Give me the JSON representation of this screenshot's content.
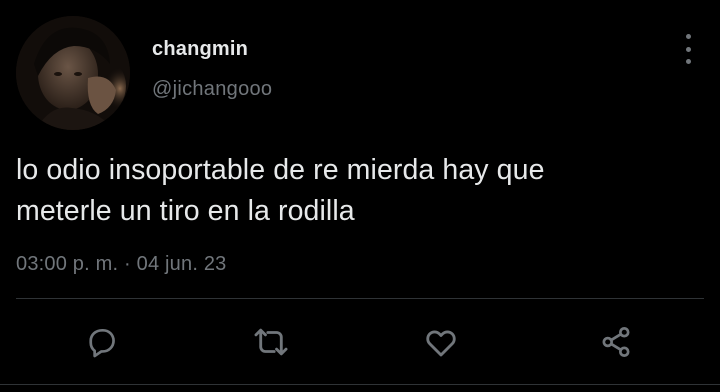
{
  "user": {
    "display_name": "changmin",
    "handle": "@jichangooo",
    "avatar": "profile-photo"
  },
  "tweet": {
    "text_line_1": "lo odio insoportable de re mierda hay que",
    "text_line_2": "meterle un tiro en la rodilla",
    "timestamp": "03:00 p. m. · 04 jun. 23"
  },
  "actions": {
    "reply_icon": "speech-bubble-icon",
    "retweet_icon": "retweet-icon",
    "like_icon": "heart-icon",
    "share_icon": "share-icon"
  },
  "colors": {
    "background": "#000000",
    "primary_text": "#e7e9ea",
    "secondary_text": "#71767b",
    "divider": "#2f3336"
  }
}
